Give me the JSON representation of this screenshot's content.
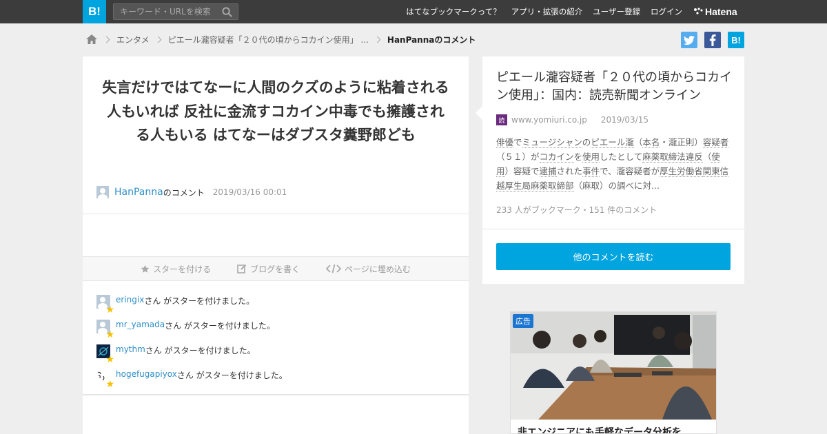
{
  "header": {
    "logo": "B!",
    "search_placeholder": "キーワード・URLを検索",
    "nav": [
      "はてなブックマークって？",
      "アプリ・拡張の紹介",
      "ユーザー登録",
      "ログイン"
    ],
    "brand": "Hatena"
  },
  "breadcrumb": {
    "items": [
      "エンタメ",
      "ピエール瀧容疑者「２０代の頃からコカイン使用」 ..."
    ],
    "current": "HanPannaのコメント"
  },
  "social": {
    "twitter": "t",
    "facebook": "f",
    "hatena": "B!"
  },
  "comment": {
    "text": "失言だけではてなーに人間のクズのように粘着される人もいれば 反社に金流すコカイン中毒でも擁護される人もいる はてなーはダブスタ糞野郎ども",
    "user": "HanPanna",
    "user_suffix": "のコメント",
    "date": "2019/03/16 00:01"
  },
  "actions": {
    "star": "スターを付ける",
    "blog": "ブログを書く",
    "embed": "ページに埋め込む"
  },
  "stars": [
    {
      "user": "eringix",
      "suffix": "さん がスターを付けました。"
    },
    {
      "user": "mr_yamada",
      "suffix": "さん がスターを付けました。"
    },
    {
      "user": "mythm",
      "suffix": "さん がスターを付けました。"
    },
    {
      "user": "hogefugapiyox",
      "suffix": "さん がスターを付けました。"
    }
  ],
  "entry": {
    "title": "ピエール瀧容疑者「２０代の頃からコカイン使用」：国内：読売新聞オンライン",
    "favicon": "読",
    "domain": "www.yomiuri.co.jp",
    "date": "2019/03/15",
    "summary": [
      {
        "t": "俳優",
        "k": true
      },
      {
        "t": "で",
        "k": false
      },
      {
        "t": "ミュージシャン",
        "k": true
      },
      {
        "t": "の",
        "k": false
      },
      {
        "t": "ピエール瀧",
        "k": true
      },
      {
        "t": "（",
        "k": false
      },
      {
        "t": "本名",
        "k": true
      },
      {
        "t": "・瀧正則）",
        "k": false
      },
      {
        "t": "容疑者",
        "k": true
      },
      {
        "t": "（５１）が",
        "k": false
      },
      {
        "t": "コカイン",
        "k": true
      },
      {
        "t": "を",
        "k": false
      },
      {
        "t": "使用",
        "k": true
      },
      {
        "t": "したとして",
        "k": false
      },
      {
        "t": "麻薬取締法違反",
        "k": true
      },
      {
        "t": "（",
        "k": false
      },
      {
        "t": "使用",
        "k": true
      },
      {
        "t": "）容疑で",
        "k": false
      },
      {
        "t": "逮捕",
        "k": true
      },
      {
        "t": "された",
        "k": false
      },
      {
        "t": "事件",
        "k": true
      },
      {
        "t": "で、瀧容疑者が",
        "k": false
      },
      {
        "t": "厚生労働省",
        "k": true
      },
      {
        "t": "関東信越厚生局麻薬取締部",
        "k": true
      },
      {
        "t": "（麻取）の調べに対...",
        "k": false
      }
    ],
    "counts": "233 人がブックマーク・151 件のコメント",
    "read_button": "他のコメントを読む"
  },
  "ad": {
    "badge": "広告",
    "caption": "非エンジニアにも手軽なデータ分析を"
  },
  "colors": {
    "accent": "#00a4de",
    "topbar": "#3c3c3c",
    "link": "#2e8ec7",
    "star": "#f5c000"
  }
}
